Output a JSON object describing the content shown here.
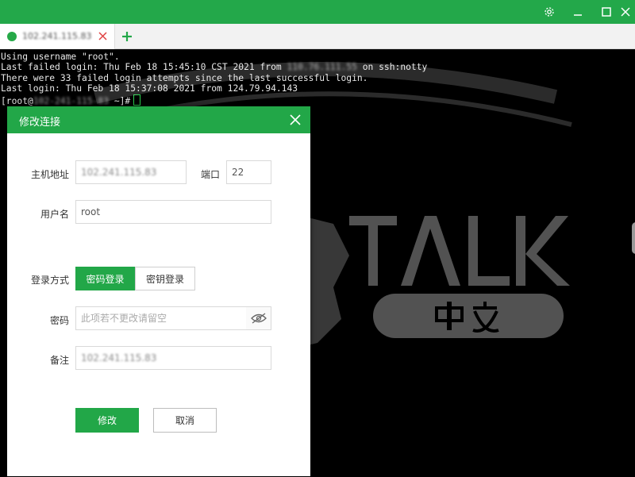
{
  "window": {
    "controls": [
      {
        "name": "settings",
        "icon": "gear-icon"
      },
      {
        "name": "minimize",
        "icon": "minimize-icon"
      },
      {
        "name": "maximize",
        "icon": "maximize-icon"
      },
      {
        "name": "close",
        "icon": "close-icon"
      }
    ],
    "accent_color": "#23a84a"
  },
  "tabs": {
    "items": [
      {
        "label": "102.241.115.83",
        "status_color": "#26a948"
      }
    ],
    "add_icon": "plus-icon"
  },
  "terminal": {
    "line1": "Using username \"root\".",
    "line2_prefix": "Last failed login: Thu Feb 18 15:45:10 CST 2021 from ",
    "line2_redacted": "110.76.111.55",
    "line2_suffix": " on ssh:notty",
    "line3": "There were 33 failed login attempts since the last successful login.",
    "line4": "Last login: Thu Feb 18 15:37:08 2021 from 124.79.94.143",
    "prompt_prefix": "[root@",
    "prompt_redacted": "102-241-115-83",
    "prompt_suffix": " ~]#"
  },
  "dialog": {
    "title": "修改连接",
    "host": {
      "label": "主机地址",
      "value": "102.241.115.83"
    },
    "port": {
      "label": "端口",
      "value": "22"
    },
    "username": {
      "label": "用户名",
      "value": "root"
    },
    "login_method": {
      "label": "登录方式",
      "options": [
        "密码登录",
        "密钥登录"
      ],
      "selected": "密码登录"
    },
    "password": {
      "label": "密码",
      "placeholder": "此项若不更改请留空",
      "toggle_icon": "eye-hidden-icon"
    },
    "note": {
      "label": "备注",
      "value": "102.241.115.83"
    },
    "submit_label": "修改",
    "cancel_label": "取消"
  }
}
